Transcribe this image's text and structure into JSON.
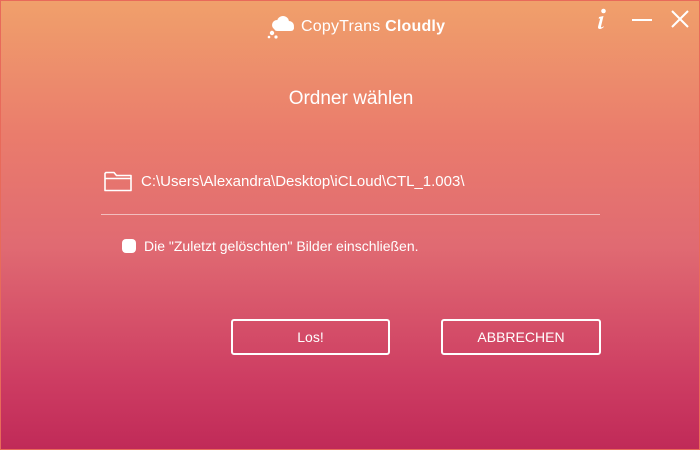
{
  "app": {
    "brand_light": "CopyTrans ",
    "brand_bold": "Cloudly"
  },
  "dialog": {
    "title": "Ordner wählen",
    "folder_path": "C:\\Users\\Alexandra\\Desktop\\iCLoud\\CTL_1.003\\",
    "include_deleted_label": "Die \"Zuletzt gelöschten\" Bilder einschließen.",
    "include_deleted_checked": false,
    "go_button": "Los!",
    "cancel_button": "ABBRECHEN"
  },
  "icons": {
    "logo": "cloud-logo-icon",
    "info": "info-icon",
    "minimize": "minimize-icon",
    "close": "close-icon",
    "folder": "folder-icon"
  },
  "colors": {
    "gradient_top": "#f0a06b",
    "gradient_bottom": "#c02a58",
    "foreground": "#ffffff"
  }
}
